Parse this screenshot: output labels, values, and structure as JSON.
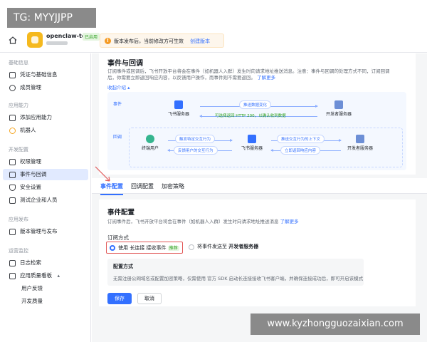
{
  "watermarks": {
    "top": "TG: MYYJJPP",
    "bottom": "www.kyzhongguozaixian.com"
  },
  "header": {
    "app_name": "openclaw-test",
    "app_badge": "已启用",
    "notice_text": "版本发布后，当前修改方可生效",
    "notice_link": "创建版本"
  },
  "sidebar": {
    "sections": [
      {
        "title": "基础信息",
        "items": [
          "凭证与基础信息",
          "成员管理"
        ]
      },
      {
        "title": "应用能力",
        "items": [
          "添加应用能力",
          "机器人"
        ]
      },
      {
        "title": "开发配置",
        "items": [
          "权限管理",
          "事件与回调",
          "安全设置",
          "测试企业和人员"
        ]
      },
      {
        "title": "应用发布",
        "items": [
          "版本管理与发布"
        ]
      },
      {
        "title": "运营监控",
        "items": [
          "日志检索",
          "应用质量看板",
          "用户反馈",
          "开发质量"
        ]
      }
    ],
    "active": "事件与回调"
  },
  "event_section": {
    "title": "事件与回调",
    "description": "订阅事件或回调后，飞书开放平台将会在事件（如机器人入群）发生时向请求地址推送消息。注意：事件与回调的处理方式不同，订阅回调后，你需要立即返回响应内容，以反馈用户操作，而事件则不需要返回。",
    "learn_more": "了解更多",
    "collapse": "收起介绍",
    "diagram": {
      "lane_event": "事件",
      "lane_callback": "回调",
      "feishu_server": "飞书服务器",
      "dev_server": "开发者服务器",
      "end_user": "终端用户",
      "push_data": "推送数据变化",
      "return_200": "可选择返回 HTTP 200，以确认收到数据",
      "trigger": "触发特定交互行为",
      "feedback": "反馈用户的交互行为",
      "push_context": "推送交互行为的上下文",
      "immediate": "立即返回响应内容"
    }
  },
  "tabs": [
    "事件配置",
    "回调配置",
    "加密策略"
  ],
  "config": {
    "title": "事件配置",
    "description": "订阅事件后，飞书开放平台将会在事件（如机器人入群）发生时向请求地址推送消息",
    "learn_more": "了解更多",
    "subscribe_label": "订阅方式",
    "option1": "使用 长连接 接收事件",
    "option1_tag": "推荐",
    "option2_prefix": "将事件发送至",
    "option2_bold": "开发者服务器",
    "cfg_title": "配置方式",
    "cfg_desc": "无需注册公网域名或配置加密策略，仅需使用 官方 SDK 启动长连接接收飞书客户端，并确保连接成功后，即可开启该模式",
    "save": "保存",
    "cancel": "取消"
  }
}
